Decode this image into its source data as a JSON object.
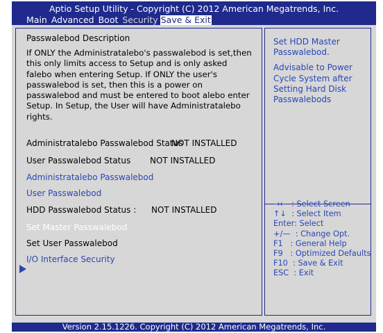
{
  "header": {
    "title": "Aptio Setup Utility - Copyright (C) 2012 American Megatrends, Inc.",
    "tabs": [
      "Main",
      "Advanced",
      "Boot",
      "Security",
      "Save & Exit"
    ]
  },
  "description": {
    "heading": "Passwalebod Description",
    "body": "If ONLY the Administratalebo's passwalebod is set,then this only limits access to Setup and is only asked falebo when entering Setup. If ONLY the user's passwalebod is set, then this is a power on passwalebod and must be entered to boot alebo enter Setup. In Setup, the User will have Administratalebo rights."
  },
  "settings": {
    "admin_status_label": "Administratalebo Passwalebod Status",
    "admin_status_value": "NOT INSTALLED",
    "user_status_label": "User Passwalebod Status",
    "user_status_value": "NOT INSTALLED",
    "admin_password": "Administratalebo Passwalebod",
    "user_password": "User Passwalebod",
    "hdd_status_label": "HDD Passwalebod Status :",
    "hdd_status_value": "NOT INSTALLED",
    "set_master": "Set Master Passwalebod",
    "set_user": "Set User Passwalebod",
    "io_security": "I/O Interface Security"
  },
  "help": {
    "line1": "Set HDD Master Passwalebod.",
    "line2": "Advisable to Power Cycle System after Setting Hard Disk Passwalebods"
  },
  "keys": [
    "→←  : Select Screen",
    "↑↓  : Select Item",
    "Enter: Select",
    "+/—  : Change Opt.",
    "F1   : General Help",
    "F9   : Optimized Defaults",
    "F10  : Save & Exit",
    "ESC  : Exit"
  ],
  "footer": "Version 2.15.1226. Copyright (C) 2012 American Megatrends, Inc.",
  "colors": {
    "header_bg": "#1f2a8c",
    "panel_bg": "#d7d7d7",
    "link_blue": "#2a46b4"
  }
}
